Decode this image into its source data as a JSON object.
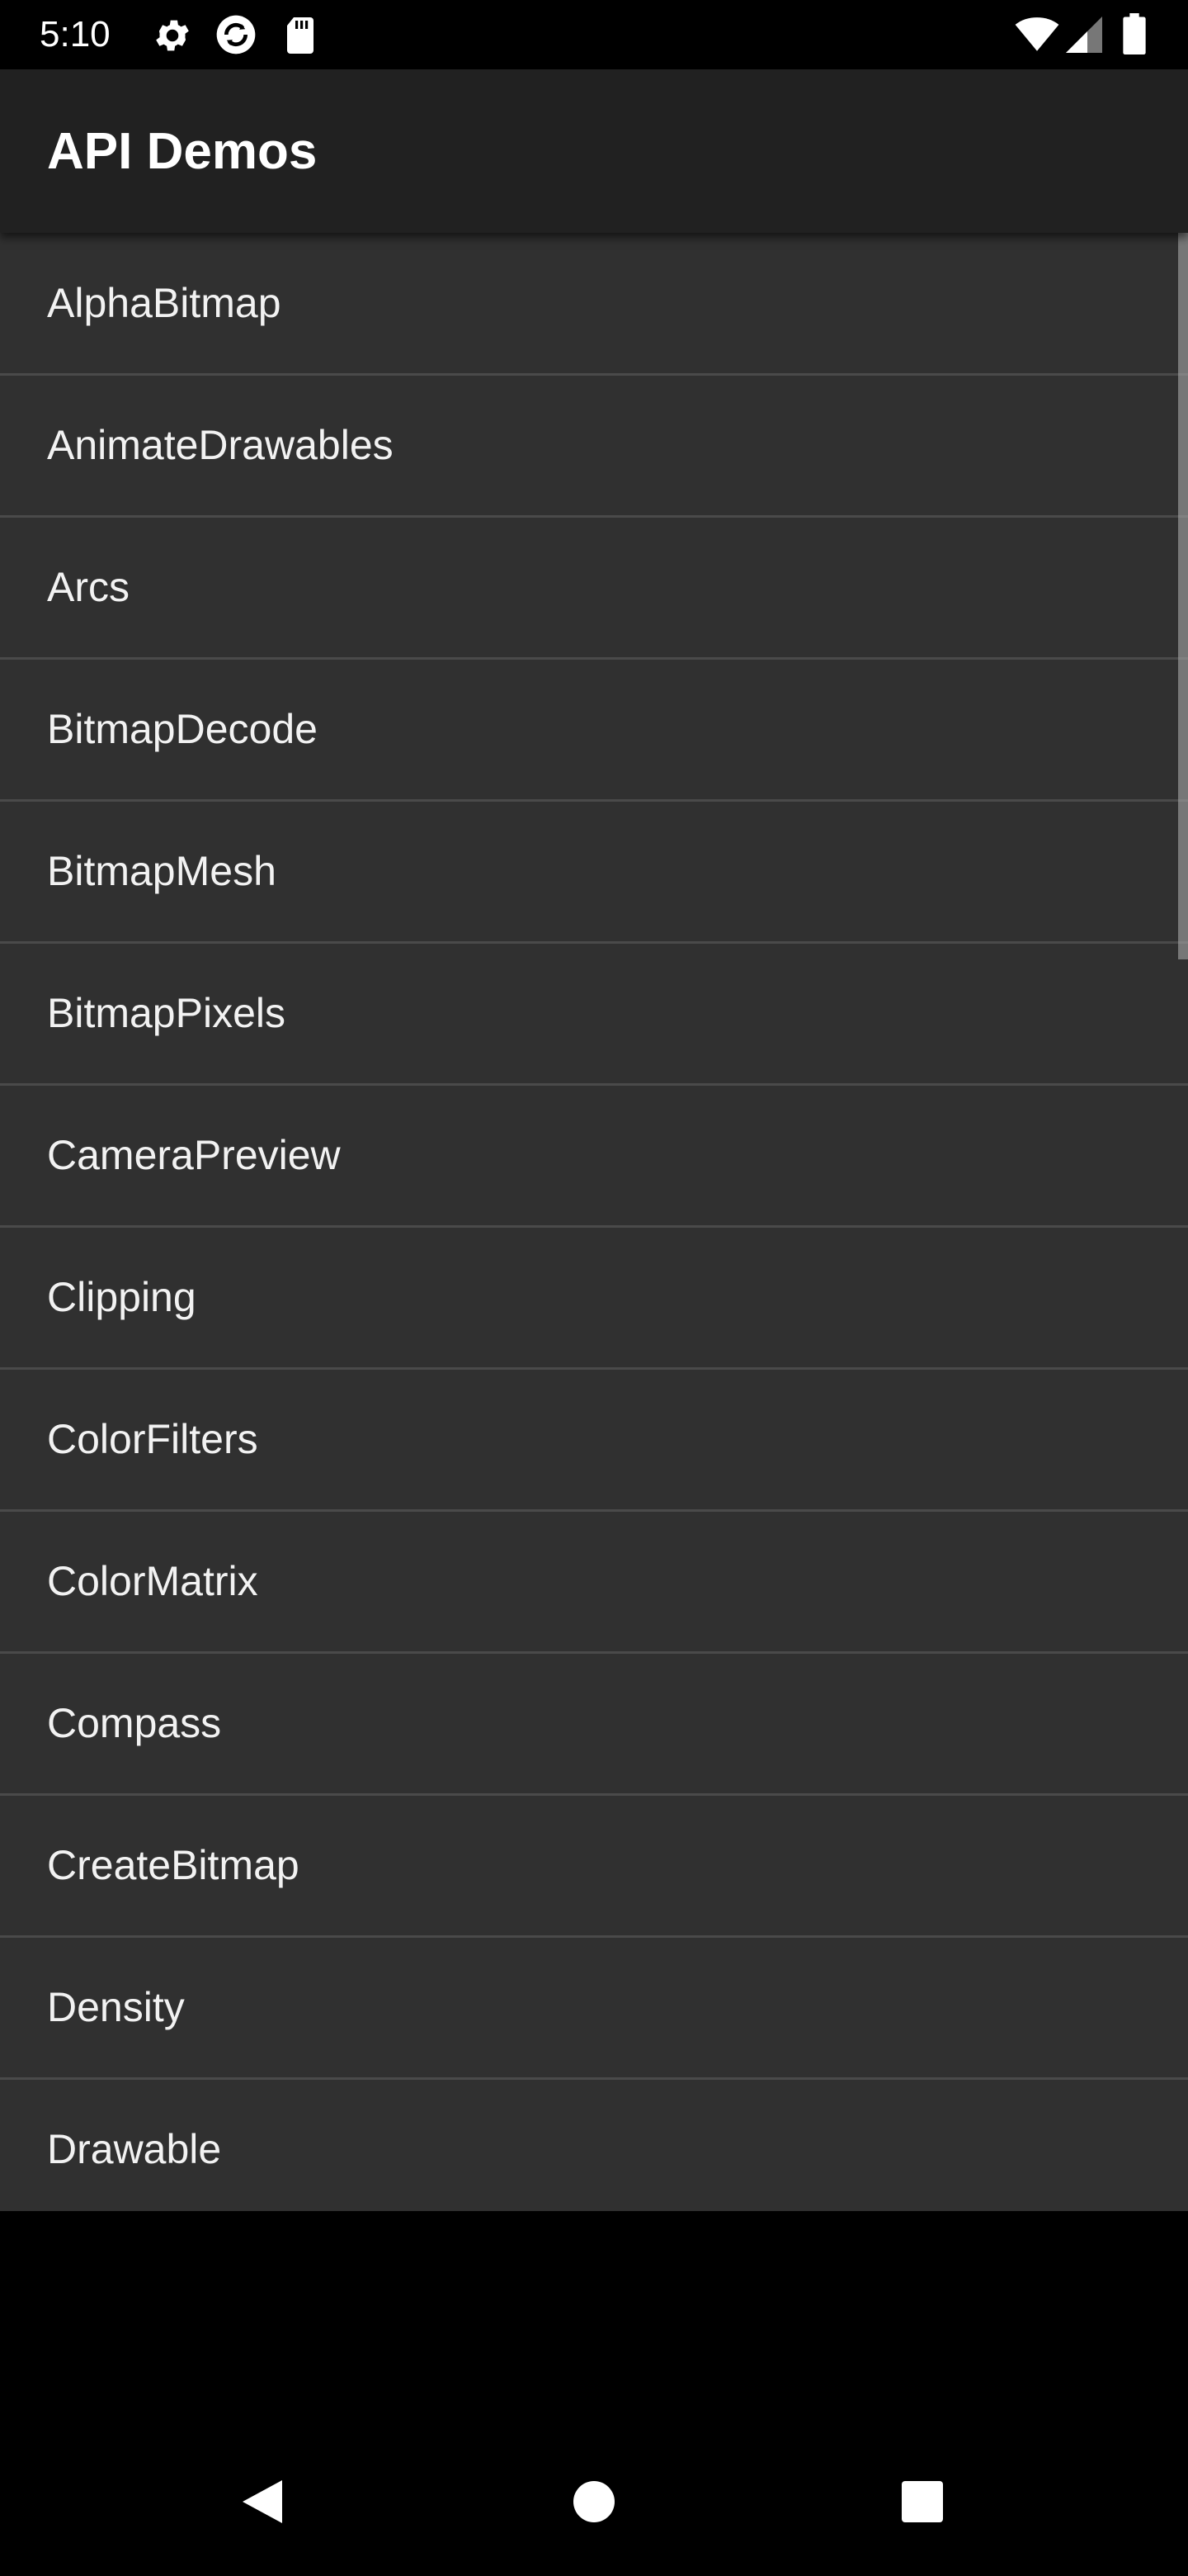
{
  "status_bar": {
    "time": "5:10",
    "icons": [
      "gear-icon",
      "sync-icon",
      "sd-card-icon",
      "wifi-icon",
      "cell-signal-icon",
      "battery-icon"
    ]
  },
  "app_bar": {
    "title": "API Demos"
  },
  "list": {
    "items": [
      {
        "label": "AlphaBitmap"
      },
      {
        "label": "AnimateDrawables"
      },
      {
        "label": "Arcs"
      },
      {
        "label": "BitmapDecode"
      },
      {
        "label": "BitmapMesh"
      },
      {
        "label": "BitmapPixels"
      },
      {
        "label": "CameraPreview"
      },
      {
        "label": "Clipping"
      },
      {
        "label": "ColorFilters"
      },
      {
        "label": "ColorMatrix"
      },
      {
        "label": "Compass"
      },
      {
        "label": "CreateBitmap"
      },
      {
        "label": "Density"
      },
      {
        "label": "Drawable"
      }
    ]
  },
  "nav_bar": {
    "buttons": [
      "back-icon",
      "home-icon",
      "recents-icon"
    ]
  },
  "colors": {
    "background": "#000000",
    "app_bar": "#212121",
    "list_background": "#303030",
    "divider": "#4a4a4a",
    "text": "#ffffff"
  }
}
